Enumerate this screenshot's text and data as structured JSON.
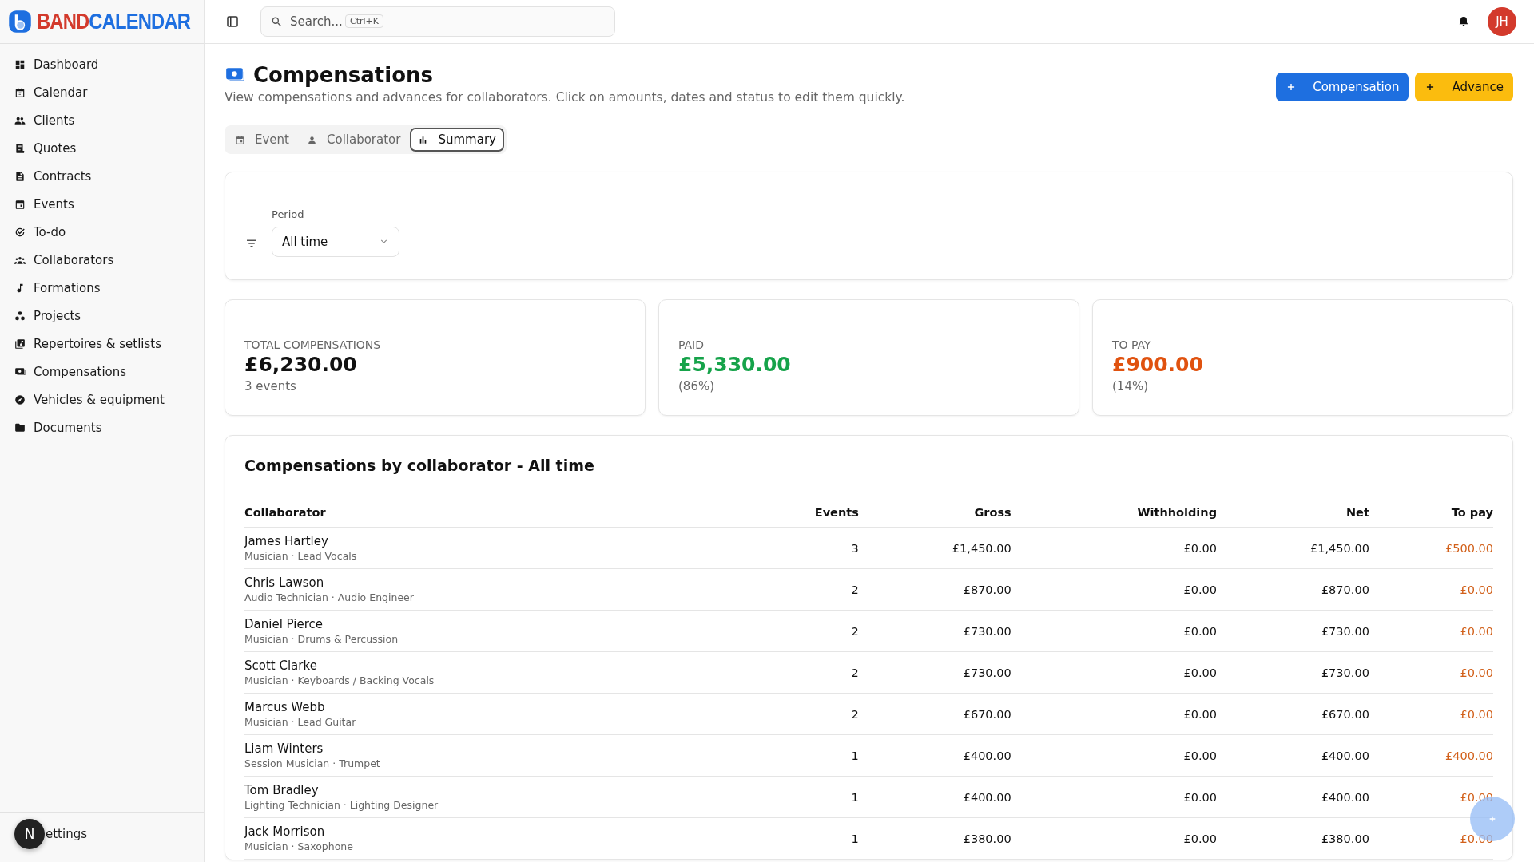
{
  "logo": {
    "part1": "BAND",
    "part2": "CALENDAR"
  },
  "sidebar": {
    "items": [
      {
        "label": "Dashboard",
        "selected": false
      },
      {
        "label": "Calendar",
        "selected": false
      },
      {
        "label": "Clients",
        "selected": false
      },
      {
        "label": "Quotes",
        "selected": false
      },
      {
        "label": "Contracts",
        "selected": false
      },
      {
        "label": "Events",
        "selected": false
      },
      {
        "label": "To-do",
        "selected": false
      },
      {
        "label": "Collaborators",
        "selected": false
      },
      {
        "label": "Formations",
        "selected": false
      },
      {
        "label": "Projects",
        "selected": false
      },
      {
        "label": "Repertoires & setlists",
        "selected": false
      },
      {
        "label": "Compensations",
        "selected": false
      },
      {
        "label": "Vehicles & equipment",
        "selected": false
      },
      {
        "label": "Documents",
        "selected": false
      }
    ],
    "footer": {
      "label": "ettings"
    }
  },
  "topbar": {
    "search": {
      "placeholder": "Search...",
      "shortcut": "Ctrl+K"
    },
    "avatar": "JH"
  },
  "page": {
    "title": "Compensations",
    "subtitle": "View compensations and advances for collaborators. Click on amounts, dates and status to edit them quickly.",
    "buttons": [
      {
        "label": "Compensation",
        "kind": "primary"
      },
      {
        "label": "Advance",
        "kind": "warning"
      }
    ],
    "tabs": [
      {
        "label": "Event",
        "selected": false
      },
      {
        "label": "Collaborator",
        "selected": false
      },
      {
        "label": "Summary",
        "selected": true
      }
    ]
  },
  "filter": {
    "label": "Period",
    "value": "All time"
  },
  "stats": [
    {
      "label": "TOTAL COMPENSATIONS",
      "value": "£6,230.00",
      "note": "3 events",
      "kind": "neutral"
    },
    {
      "label": "PAID",
      "value": "£5,330.00",
      "note": "(86%)",
      "kind": "positive"
    },
    {
      "label": "TO PAY",
      "value": "£900.00",
      "note": "(14%)",
      "kind": "warning"
    }
  ],
  "table": {
    "title": "Compensations by collaborator - All time",
    "columns": [
      "Collaborator",
      "Events",
      "Gross",
      "Withholding",
      "Net",
      "To pay"
    ],
    "rows": [
      {
        "name": "James Hartley",
        "role": "Musician · Lead Vocals",
        "events": "3",
        "gross": "£1,450.00",
        "withholding": "£0.00",
        "net": "£1,450.00",
        "to_pay": "£500.00"
      },
      {
        "name": "Chris Lawson",
        "role": "Audio Technician · Audio Engineer",
        "events": "2",
        "gross": "£870.00",
        "withholding": "£0.00",
        "net": "£870.00",
        "to_pay": "£0.00"
      },
      {
        "name": "Daniel Pierce",
        "role": "Musician · Drums & Percussion",
        "events": "2",
        "gross": "£730.00",
        "withholding": "£0.00",
        "net": "£730.00",
        "to_pay": "£0.00"
      },
      {
        "name": "Scott Clarke",
        "role": "Musician · Keyboards / Backing Vocals",
        "events": "2",
        "gross": "£730.00",
        "withholding": "£0.00",
        "net": "£730.00",
        "to_pay": "£0.00"
      },
      {
        "name": "Marcus Webb",
        "role": "Musician · Lead Guitar",
        "events": "2",
        "gross": "£670.00",
        "withholding": "£0.00",
        "net": "£670.00",
        "to_pay": "£0.00"
      },
      {
        "name": "Liam Winters",
        "role": "Session Musician · Trumpet",
        "events": "1",
        "gross": "£400.00",
        "withholding": "£0.00",
        "net": "£400.00",
        "to_pay": "£400.00"
      },
      {
        "name": "Tom Bradley",
        "role": "Lighting Technician · Lighting Designer",
        "events": "1",
        "gross": "£400.00",
        "withholding": "£0.00",
        "net": "£400.00",
        "to_pay": "£0.00"
      },
      {
        "name": "Jack Morrison",
        "role": "Musician · Saxophone",
        "events": "1",
        "gross": "£380.00",
        "withholding": "£0.00",
        "net": "£380.00",
        "to_pay": "£0.00"
      }
    ]
  },
  "dev_badge": "N"
}
